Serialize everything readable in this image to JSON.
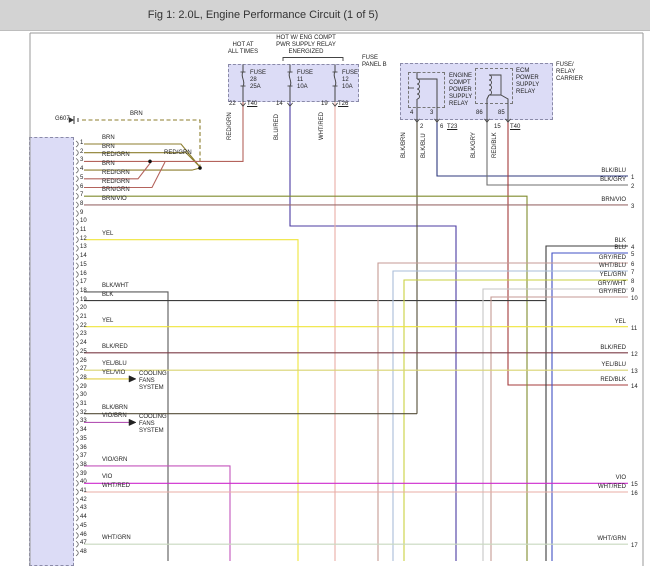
{
  "header": {
    "title": "Fig 1: 2.0L, Engine Performance Circuit (1 of 5)"
  },
  "ground": {
    "label": "G607",
    "wire_label": "BRN"
  },
  "junction_label": "RED/GRN",
  "fuse_panel": {
    "label_lines": [
      "FUSE",
      "PANEL B"
    ],
    "hot_at": [
      "HOT AT",
      "ALL TIMES"
    ],
    "hot_relay": [
      "HOT W/ ENG COMPT",
      "PWR SUPPLY RELAY",
      "ENERGIZED"
    ],
    "fuses": [
      {
        "lines": [
          "FUSE",
          "28",
          "25A"
        ],
        "pin": "22",
        "conn": "T40",
        "wire": "RED/GRN"
      },
      {
        "lines": [
          "FUSE",
          "11",
          "10A"
        ],
        "pin": "14",
        "conn": "",
        "wire": "BLU/RED"
      },
      {
        "lines": [
          "FUSE",
          "12",
          "10A"
        ],
        "pin": "19",
        "conn": "T26",
        "wire": "WHT/RED"
      }
    ]
  },
  "relay_carrier": {
    "label_lines": [
      "FUSE/",
      "RELAY",
      "CARRIER"
    ],
    "engine_relay": {
      "label_lines": [
        "ENGINE",
        "COMPT",
        "POWER",
        "SUPPLY",
        "RELAY"
      ],
      "pin_left": "4",
      "pin_right": "3"
    },
    "ecm_relay": {
      "label_lines": [
        "ECM",
        "POWER",
        "SUPPLY",
        "RELAY"
      ],
      "pin_left": "86",
      "pin_right": "85"
    },
    "wire_drops": [
      {
        "name": "BLK/BRN",
        "pin": "2",
        "conn": ""
      },
      {
        "name": "BLK/BLU",
        "pin": "6",
        "conn": "T23"
      },
      {
        "name": "BLK/GRY",
        "pin": "",
        "conn": ""
      },
      {
        "name": "RED/BLK",
        "pin": "15",
        "conn": "T40"
      }
    ]
  },
  "cooling_fans": [
    "COOLING",
    "FANS",
    "SYSTEM"
  ],
  "connector": {
    "pins": [
      {
        "n": "1",
        "wire": "BRN"
      },
      {
        "n": "2",
        "wire": "BRN"
      },
      {
        "n": "3",
        "wire": "RED/GRN"
      },
      {
        "n": "4",
        "wire": "BRN"
      },
      {
        "n": "5",
        "wire": "RED/GRN"
      },
      {
        "n": "6",
        "wire": "RED/GRN"
      },
      {
        "n": "7",
        "wire": "BRN/GRN"
      },
      {
        "n": "8",
        "wire": "BRN/VIO"
      },
      {
        "n": "9",
        "wire": ""
      },
      {
        "n": "10",
        "wire": ""
      },
      {
        "n": "11",
        "wire": ""
      },
      {
        "n": "12",
        "wire": "YEL"
      },
      {
        "n": "13",
        "wire": ""
      },
      {
        "n": "14",
        "wire": ""
      },
      {
        "n": "15",
        "wire": ""
      },
      {
        "n": "16",
        "wire": ""
      },
      {
        "n": "17",
        "wire": ""
      },
      {
        "n": "18",
        "wire": "BLK/WHT"
      },
      {
        "n": "19",
        "wire": "BLK"
      },
      {
        "n": "20",
        "wire": ""
      },
      {
        "n": "21",
        "wire": ""
      },
      {
        "n": "22",
        "wire": "YEL"
      },
      {
        "n": "23",
        "wire": ""
      },
      {
        "n": "24",
        "wire": ""
      },
      {
        "n": "25",
        "wire": "BLK/RED"
      },
      {
        "n": "26",
        "wire": ""
      },
      {
        "n": "27",
        "wire": "YEL/BLU"
      },
      {
        "n": "28",
        "wire": "YEL/VIO"
      },
      {
        "n": "29",
        "wire": ""
      },
      {
        "n": "30",
        "wire": ""
      },
      {
        "n": "31",
        "wire": ""
      },
      {
        "n": "32",
        "wire": "BLK/BRN"
      },
      {
        "n": "33",
        "wire": "VIO/BRN"
      },
      {
        "n": "34",
        "wire": ""
      },
      {
        "n": "35",
        "wire": ""
      },
      {
        "n": "36",
        "wire": ""
      },
      {
        "n": "37",
        "wire": ""
      },
      {
        "n": "38",
        "wire": "VIO/GRN"
      },
      {
        "n": "39",
        "wire": ""
      },
      {
        "n": "40",
        "wire": "VIO"
      },
      {
        "n": "41",
        "wire": "WHT/RED"
      },
      {
        "n": "42",
        "wire": ""
      },
      {
        "n": "43",
        "wire": ""
      },
      {
        "n": "44",
        "wire": ""
      },
      {
        "n": "45",
        "wire": ""
      },
      {
        "n": "46",
        "wire": ""
      },
      {
        "n": "47",
        "wire": "WHT/GRN"
      },
      {
        "n": "48",
        "wire": ""
      }
    ]
  },
  "right_labels": [
    {
      "n": "1",
      "wire": "BLK/BLU"
    },
    {
      "n": "2",
      "wire": "BLK/GRY"
    },
    {
      "n": "3",
      "wire": "BRN/VIO"
    },
    {
      "n": "4",
      "wire": "BLK"
    },
    {
      "n": "5",
      "wire": "BLU"
    },
    {
      "n": "6",
      "wire": "GRY/RED"
    },
    {
      "n": "7",
      "wire": "WHT/BLU"
    },
    {
      "n": "8",
      "wire": "YEL/GRN"
    },
    {
      "n": "9",
      "wire": "GRY/WHT"
    },
    {
      "n": "10",
      "wire": "GRY/RED"
    },
    {
      "n": "11",
      "wire": "YEL"
    },
    {
      "n": "12",
      "wire": "BLK/RED"
    },
    {
      "n": "13",
      "wire": "YEL/BLU"
    },
    {
      "n": "14",
      "wire": "RED/BLK"
    },
    {
      "n": "15",
      "wire": "VIO"
    },
    {
      "n": "16",
      "wire": "WHT/RED"
    },
    {
      "n": "17",
      "wire": "WHT/GRN"
    }
  ],
  "colors": {
    "BRN": "#8c7e2e",
    "RED/GRN": "#b4635c",
    "BRN/GRN": "#808c2e",
    "BRN/VIO": "#9b6c6c",
    "YEL": "#efe53c",
    "BLK/WHT": "#5a5a5a",
    "BLK": "#3d3d3d",
    "BLK/RED": "#7c3c46",
    "YEL/BLU": "#d9d470",
    "YEL/VIO": "#e2cf44",
    "BLK/BRN": "#554e3a",
    "VIO/BRN": "#b455b4",
    "VIO/GRN": "#c455bc",
    "VIO": "#ce2ace",
    "WHT/RED": "#e9aca6",
    "WHT/GRN": "#c9d9bf",
    "BLU/RED": "#4b3ba2",
    "BLK/BLU": "#2f3a7e",
    "BLK/GRY": "#6f6f6f",
    "RED/BLK": "#a43b3b",
    "BLU": "#4050c4",
    "GRY/RED": "#c59a94",
    "WHT/BLU": "#aabdd8",
    "YEL/GRN": "#c9d242",
    "GRY/WHT": "#c6c6c6",
    "border": "#9a9a9a",
    "symbol": "#444444"
  }
}
